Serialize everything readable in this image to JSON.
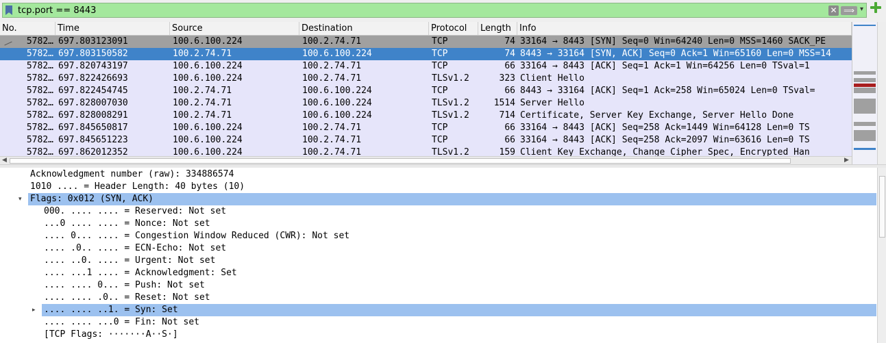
{
  "filter": {
    "value": "tcp.port == 8443",
    "bookmark_icon": "bookmark-icon",
    "clear_icon": "clear-icon",
    "clear_glyph": "✕",
    "apply_icon": "arrow-right-icon",
    "apply_glyph": "⟹",
    "dropdown_glyph": "▾",
    "add_icon": "plus-icon",
    "bg_color": "#a4e89d"
  },
  "columns": [
    {
      "key": "no",
      "label": "No."
    },
    {
      "key": "time",
      "label": "Time"
    },
    {
      "key": "source",
      "label": "Source"
    },
    {
      "key": "destination",
      "label": "Destination"
    },
    {
      "key": "protocol",
      "label": "Protocol"
    },
    {
      "key": "length",
      "label": "Length"
    },
    {
      "key": "info",
      "label": "Info"
    }
  ],
  "packets": [
    {
      "no": "5782…",
      "time": "697.803123091",
      "source": "100.6.100.224",
      "destination": "100.2.74.71",
      "protocol": "TCP",
      "length": "74",
      "info": "33164 → 8443 [SYN] Seq=0 Win=64240 Len=0 MSS=1460 SACK_PE",
      "style": "gray"
    },
    {
      "no": "5782…",
      "time": "697.803150582",
      "source": "100.2.74.71",
      "destination": "100.6.100.224",
      "protocol": "TCP",
      "length": "74",
      "info": "8443 → 33164 [SYN, ACK] Seq=0 Ack=1 Win=65160 Len=0 MSS=14",
      "style": "sel"
    },
    {
      "no": "5782…",
      "time": "697.820743197",
      "source": "100.6.100.224",
      "destination": "100.2.74.71",
      "protocol": "TCP",
      "length": "66",
      "info": "33164 → 8443 [ACK] Seq=1 Ack=1 Win=64256 Len=0 TSval=1",
      "style": "norm"
    },
    {
      "no": "5782…",
      "time": "697.822426693",
      "source": "100.6.100.224",
      "destination": "100.2.74.71",
      "protocol": "TLSv1.2",
      "length": "323",
      "info": "Client Hello",
      "style": "norm"
    },
    {
      "no": "5782…",
      "time": "697.822454745",
      "source": "100.2.74.71",
      "destination": "100.6.100.224",
      "protocol": "TCP",
      "length": "66",
      "info": "8443 → 33164 [ACK] Seq=1 Ack=258 Win=65024 Len=0 TSval=",
      "style": "norm"
    },
    {
      "no": "5782…",
      "time": "697.828007030",
      "source": "100.2.74.71",
      "destination": "100.6.100.224",
      "protocol": "TLSv1.2",
      "length": "1514",
      "info": "Server Hello",
      "style": "norm"
    },
    {
      "no": "5782…",
      "time": "697.828008291",
      "source": "100.2.74.71",
      "destination": "100.6.100.224",
      "protocol": "TLSv1.2",
      "length": "714",
      "info": "Certificate, Server Key Exchange, Server Hello Done",
      "style": "norm"
    },
    {
      "no": "5782…",
      "time": "697.845650817",
      "source": "100.6.100.224",
      "destination": "100.2.74.71",
      "protocol": "TCP",
      "length": "66",
      "info": "33164 → 8443 [ACK] Seq=258 Ack=1449 Win=64128 Len=0 TS",
      "style": "norm"
    },
    {
      "no": "5782…",
      "time": "697.845651223",
      "source": "100.6.100.224",
      "destination": "100.2.74.71",
      "protocol": "TCP",
      "length": "66",
      "info": "33164 → 8443 [ACK] Seq=258 Ack=2097 Win=63616 Len=0 TS",
      "style": "norm"
    },
    {
      "no": "5782…",
      "time": "697.862012352",
      "source": "100.6.100.224",
      "destination": "100.2.74.71",
      "protocol": "TLSv1.2",
      "length": "159",
      "info": "Client Key Exchange, Change Cipher Spec, Encrypted Han",
      "style": "norm"
    }
  ],
  "colors": {
    "row_normal": "#e6e5fa",
    "row_gray": "#a0a0a0",
    "row_selected": "#3f83c9",
    "detail_highlight": "#9cc1ef"
  },
  "scroll_glyphs": {
    "left": "◀",
    "right": "▶"
  },
  "details": [
    {
      "text": "Acknowledgment number (raw): 334886574",
      "indent": 1,
      "arrow": "",
      "hl": false
    },
    {
      "text": "1010 .... = Header Length: 40 bytes (10)",
      "indent": 1,
      "arrow": "",
      "hl": false
    },
    {
      "text": "Flags: 0x012 (SYN, ACK)",
      "indent": 1,
      "arrow": "▾",
      "hl": true
    },
    {
      "text": "000. .... .... = Reserved: Not set",
      "indent": 2,
      "arrow": "",
      "hl": false
    },
    {
      "text": "...0 .... .... = Nonce: Not set",
      "indent": 2,
      "arrow": "",
      "hl": false
    },
    {
      "text": ".... 0... .... = Congestion Window Reduced (CWR): Not set",
      "indent": 2,
      "arrow": "",
      "hl": false
    },
    {
      "text": ".... .0.. .... = ECN-Echo: Not set",
      "indent": 2,
      "arrow": "",
      "hl": false
    },
    {
      "text": ".... ..0. .... = Urgent: Not set",
      "indent": 2,
      "arrow": "",
      "hl": false
    },
    {
      "text": ".... ...1 .... = Acknowledgment: Set",
      "indent": 2,
      "arrow": "",
      "hl": false
    },
    {
      "text": ".... .... 0... = Push: Not set",
      "indent": 2,
      "arrow": "",
      "hl": false
    },
    {
      "text": ".... .... .0.. = Reset: Not set",
      "indent": 2,
      "arrow": "",
      "hl": false
    },
    {
      "text": ".... .... ..1. = Syn: Set",
      "indent": 2,
      "arrow": "▸",
      "hl": true
    },
    {
      "text": ".... .... ...0 = Fin: Not set",
      "indent": 2,
      "arrow": "",
      "hl": false
    },
    {
      "text": "[TCP Flags: ·······A··S·]",
      "indent": 2,
      "arrow": "",
      "hl": false
    }
  ]
}
